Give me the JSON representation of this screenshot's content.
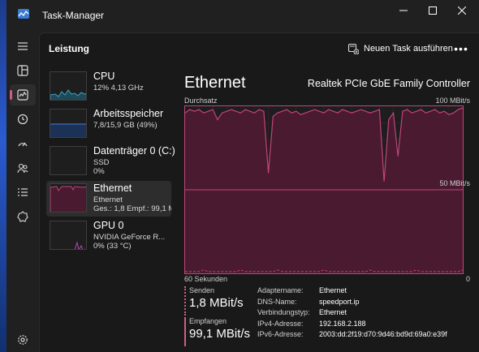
{
  "window": {
    "title": "Task-Manager",
    "controls": {
      "minimize": "—",
      "maximize": "☐",
      "close": "✕"
    }
  },
  "sidebar": {
    "items": [
      {
        "icon": "hamburger-icon"
      },
      {
        "icon": "processes-icon"
      },
      {
        "icon": "performance-icon",
        "active": true
      },
      {
        "icon": "history-icon"
      },
      {
        "icon": "startup-icon"
      },
      {
        "icon": "users-icon"
      },
      {
        "icon": "details-icon"
      },
      {
        "icon": "services-icon"
      },
      {
        "icon": "settings-icon"
      }
    ]
  },
  "header": {
    "title": "Leistung",
    "run_task_label": "Neuen Task ausführen",
    "more_label": "•••"
  },
  "devices": [
    {
      "name": "CPU",
      "line1": "12% 4,13 GHz",
      "line2": ""
    },
    {
      "name": "Arbeitsspeicher",
      "line1": "7,8/15,9 GB (49%)",
      "line2": ""
    },
    {
      "name": "Datenträger 0 (C:)",
      "line1": "SSD",
      "line2": "0%"
    },
    {
      "name": "Ethernet",
      "line1": "Ethernet",
      "line2": "Ges.: 1,8 Empf.: 99,1 MB",
      "active": true
    },
    {
      "name": "GPU 0",
      "line1": "NVIDIA GeForce R...",
      "line2": "0% (33 °C)"
    }
  ],
  "detail": {
    "title": "Ethernet",
    "adapter": "Realtek PCIe GbE Family Controller",
    "graph_left_label": "Durchsatz",
    "graph_right_label": "100 MBit/s",
    "mid_label": "50 MBit/s",
    "time_left": "60 Sekunden",
    "time_right": "0",
    "send_label": "Senden",
    "send_value": "1,8 MBit/s",
    "recv_label": "Empfangen",
    "recv_value": "99,1 MBit/s",
    "properties": [
      {
        "key": "Adaptername:",
        "value": "Ethernet"
      },
      {
        "key": "DNS-Name:",
        "value": "speedport.ip"
      },
      {
        "key": "Verbindungstyp:",
        "value": "Ethernet"
      },
      {
        "key": "IPv4-Adresse:",
        "value": "192.168.2.188"
      },
      {
        "key": "IPv6-Adresse:",
        "value": "2003:dd:2f19:d70:9d46:bd9d:69a0:e39f"
      }
    ]
  },
  "colors": {
    "accent": "#d05c8a",
    "graph_line": "#c2447a",
    "graph_fill": "#4a1a30",
    "cpu": "#3fa0c0",
    "memory": "#4a7fd0",
    "disk": "#7ab04a",
    "gpu": "#b04ab0"
  },
  "throughput": {
    "unit": "MBit/s",
    "max": 100,
    "receive": [
      96,
      98,
      97,
      98,
      96,
      97,
      98,
      92,
      96,
      97,
      98,
      97,
      96,
      98,
      97,
      96,
      98,
      97,
      60,
      94,
      96,
      97,
      98,
      96,
      97,
      95,
      96,
      97,
      98,
      97,
      96,
      98,
      97,
      96,
      98,
      97,
      96,
      97,
      98,
      97,
      96,
      97,
      98,
      55,
      92,
      96,
      70,
      97,
      98,
      96,
      97,
      98,
      96,
      97,
      98,
      96,
      97,
      95,
      96,
      98,
      99
    ],
    "send": [
      1,
      1,
      1,
      1,
      2,
      1,
      1,
      1,
      1,
      1,
      1,
      1,
      2,
      1,
      1,
      1,
      1,
      1,
      1,
      1,
      2,
      1,
      1,
      1,
      1,
      1,
      1,
      1,
      1,
      1,
      2,
      1,
      1,
      1,
      1,
      1,
      1,
      1,
      1,
      1,
      2,
      1,
      1,
      1,
      1,
      1,
      1,
      1,
      1,
      1,
      2,
      1,
      1,
      1,
      1,
      1,
      1,
      1,
      1,
      1,
      2
    ]
  }
}
